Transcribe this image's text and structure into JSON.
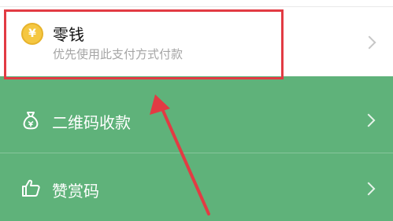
{
  "wallet_item": {
    "title": "零钱",
    "subtitle": "优先使用此支付方式付款",
    "coin_symbol": "¥",
    "icon": "coin-icon"
  },
  "menu_items": [
    {
      "label": "二维码收款",
      "icon": "money-bag-icon"
    },
    {
      "label": "赞赏码",
      "icon": "thumbs-up-icon"
    }
  ],
  "colors": {
    "background_green": "#5fb27a",
    "highlight_red": "#e23b43",
    "coin_yellow": "#f5c741"
  }
}
